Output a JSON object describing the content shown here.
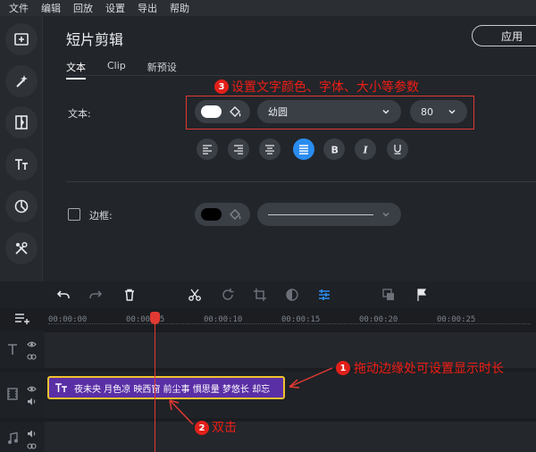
{
  "menu": [
    "文件",
    "编辑",
    "回放",
    "设置",
    "导出",
    "帮助"
  ],
  "sidebar": {
    "items": [
      {
        "icon": "import-media-icon"
      },
      {
        "icon": "magic-wand-icon"
      },
      {
        "icon": "transition-icon"
      },
      {
        "icon": "titles-icon"
      },
      {
        "icon": "stickers-icon"
      },
      {
        "icon": "tools-icon"
      }
    ]
  },
  "panel": {
    "title": "短片剪辑",
    "apply_label": "应用",
    "tabs": [
      "文本",
      "Clip",
      "新预设"
    ],
    "text_label": "文本:",
    "font_value": "幼圆",
    "size_value": "80",
    "border_label": "边框:"
  },
  "annotations": {
    "a3": {
      "num": "3",
      "text": "设置文字颜色、字体、大小等参数"
    },
    "a1": {
      "num": "1",
      "text": "拖动边缘处可设置显示时长"
    },
    "a2": {
      "num": "2",
      "text": "双击"
    }
  },
  "timeline": {
    "ticks": [
      "00:00:00",
      "00:00:05",
      "00:00:10",
      "00:00:15",
      "00:00:20",
      "00:00:25"
    ],
    "clip_text": "夜未央 月色凉 映西窗 前尘事 惧思量 梦悠长 却忘"
  },
  "colors": {
    "accent": "#2a8cf0",
    "annotation": "#e23a32",
    "clip": "#5a2fa6",
    "clip_border": "#f2c230"
  }
}
